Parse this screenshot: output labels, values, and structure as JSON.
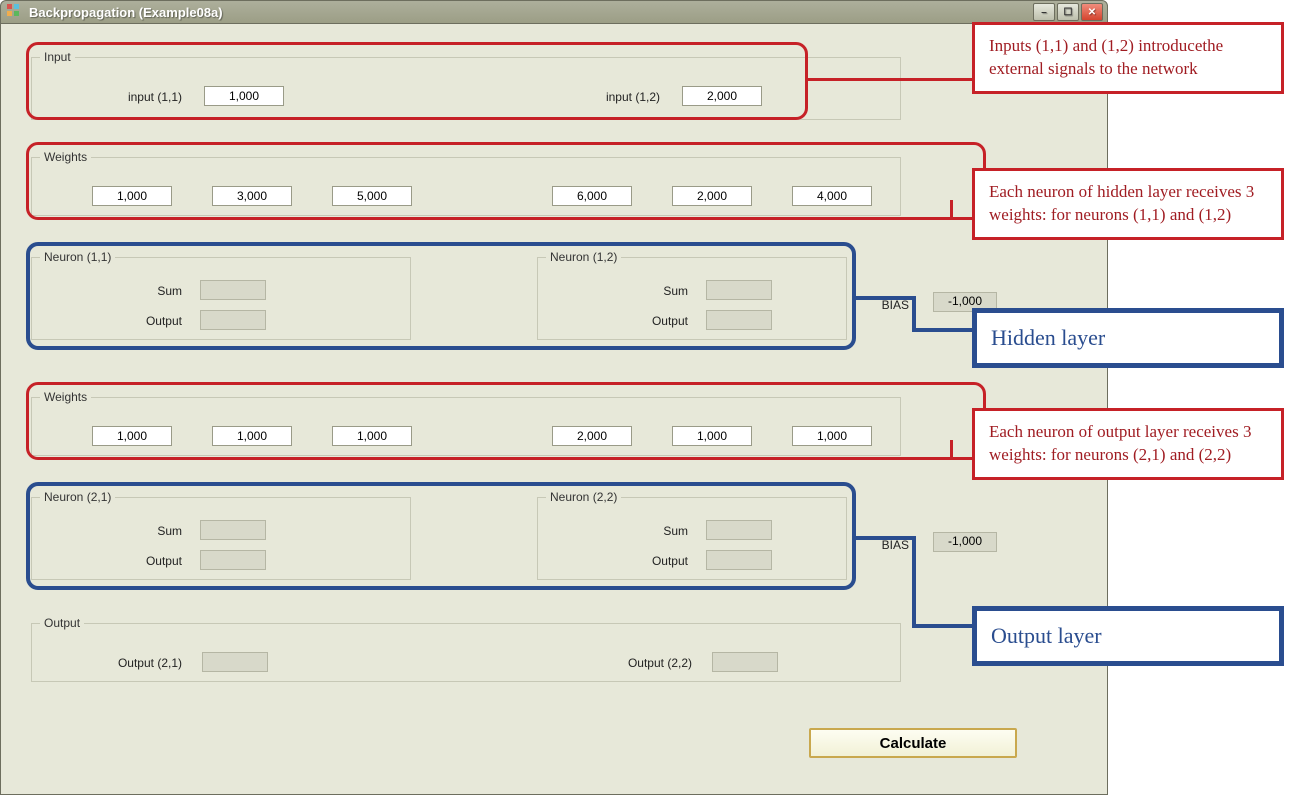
{
  "window": {
    "title": "Backpropagation (Example08a)"
  },
  "input_group": {
    "legend": "Input",
    "label1": "input (1,1)",
    "value1": "1,000",
    "label2": "input (1,2)",
    "value2": "2,000"
  },
  "weights1": {
    "legend": "Weights",
    "values": [
      "1,000",
      "3,000",
      "5,000",
      "6,000",
      "2,000",
      "4,000"
    ]
  },
  "hidden": {
    "neuron1": {
      "legend": "Neuron (1,1)",
      "sum_label": "Sum",
      "out_label": "Output"
    },
    "neuron2": {
      "legend": "Neuron (1,2)",
      "sum_label": "Sum",
      "out_label": "Output"
    },
    "bias_label": "BIAS",
    "bias_value": "-1,000"
  },
  "weights2": {
    "legend": "Weights",
    "values": [
      "1,000",
      "1,000",
      "1,000",
      "2,000",
      "1,000",
      "1,000"
    ]
  },
  "output_neurons": {
    "neuron1": {
      "legend": "Neuron (2,1)",
      "sum_label": "Sum",
      "out_label": "Output"
    },
    "neuron2": {
      "legend": "Neuron (2,2)",
      "sum_label": "Sum",
      "out_label": "Output"
    },
    "bias_label": "BIAS",
    "bias_value": "-1,000"
  },
  "output_group": {
    "legend": "Output",
    "label1": "Output (2,1)",
    "label2": "Output (2,2)"
  },
  "calculate_label": "Calculate",
  "annotations": {
    "a1": "Inputs (1,1) and (1,2) introducethe external signals to the network",
    "a2": "Each neuron of hidden layer receives 3 weights: for neurons (1,1) and (1,2)",
    "a3": "Hidden layer",
    "a4": "Each neuron of output layer receives 3 weights: for neurons (2,1) and (2,2)",
    "a5": "Output layer"
  }
}
